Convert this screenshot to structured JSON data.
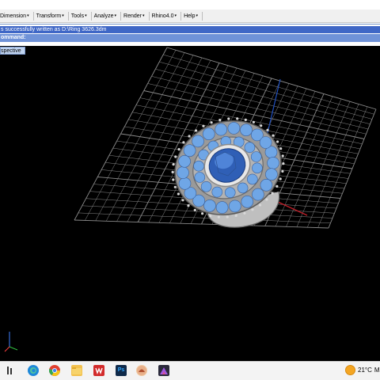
{
  "menu": {
    "items": [
      {
        "label": "Dimension",
        "arrow": "▾"
      },
      {
        "label": "Transform",
        "arrow": "▾"
      },
      {
        "label": "Tools",
        "arrow": "▾"
      },
      {
        "label": "Analyze",
        "arrow": "▾"
      },
      {
        "label": "Render",
        "arrow": "▾"
      },
      {
        "label": "Rhino4.0",
        "arrow": "▾"
      },
      {
        "label": "Help",
        "arrow": "▾"
      }
    ]
  },
  "command_area": {
    "history": "s successfully written as D:\\Ring 3626.3dm",
    "prompt": "ommand:"
  },
  "viewport": {
    "name": "spective",
    "background": "#000000",
    "grid_color": "#8a8a8a",
    "x_axis_color": "#c0202a",
    "y_axis_color": "#2050c0",
    "model": {
      "center_stone_color": "#3a6fc8",
      "small_stones_color": "#6fa6e6",
      "metal_color": "#8c8c8c"
    }
  },
  "taskbar": {
    "icons": [
      {
        "name": "task-view-icon",
        "color": "#333333"
      },
      {
        "name": "edge-icon",
        "color": "#1e88d8"
      },
      {
        "name": "chrome-icon",
        "color": "#e04030"
      },
      {
        "name": "file-explorer-icon",
        "color": "#f2c14e"
      },
      {
        "name": "wps-icon",
        "color": "#d22b2b"
      },
      {
        "name": "photoshop-icon",
        "color": "#0f2a4a"
      },
      {
        "name": "rhino-icon",
        "color": "#b05030"
      },
      {
        "name": "app-icon",
        "color": "#7d3fc4"
      }
    ],
    "weather": {
      "temperature": "21°C",
      "suffix": "M"
    },
    "photoshop_label": "Ps"
  }
}
